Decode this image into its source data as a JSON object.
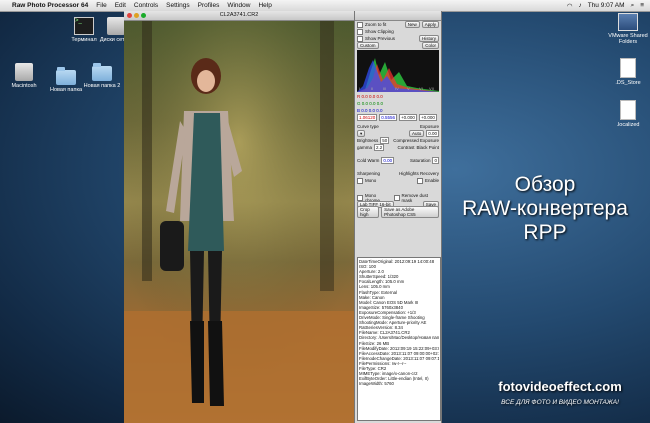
{
  "menubar": {
    "app_name": "Raw Photo Processor 64",
    "items": [
      "File",
      "Edit",
      "Controls",
      "Settings",
      "Profiles",
      "Window",
      "Help"
    ],
    "clock": "Thu 9:07 AM"
  },
  "desktop_icons": [
    {
      "label": "Терминал",
      "kind": "terminal"
    },
    {
      "label": "Диски сети 2",
      "kind": "drive"
    },
    {
      "label": "Macintosh",
      "kind": "drive"
    },
    {
      "label": "Новая папка",
      "kind": "folder"
    },
    {
      "label": "Новая папка 2",
      "kind": "folder"
    },
    {
      "label": "VMware Shared Folders",
      "kind": "apps"
    },
    {
      "label": ".DS_Store",
      "kind": "doc"
    },
    {
      "label": ".localized",
      "kind": "doc"
    }
  ],
  "photo_window": {
    "title": "CL2A3741.CR2"
  },
  "panel": {
    "zoom_to_fit": "Zoom to fit",
    "show_clipping": "Show Clipping",
    "show_previous": "Show Previous",
    "btn_apply": "Apply",
    "btn_new": "New",
    "btn_history": "History",
    "custom": "Custom",
    "color": "Color",
    "hist_labels": [
      "I",
      "II",
      "III",
      "IV",
      "V",
      "VI",
      "VII"
    ],
    "rgb_r": "R 0.0 0.0 0.0",
    "rgb_g": "G 0.0 0.0 0.0",
    "rgb_b": "B 0.0 0.0 0.0",
    "v1": "1.06120",
    "v2": "0.5556",
    "v3": "+0.000",
    "v4": "+0.000",
    "curve_type": "Curve type",
    "exposure": "Exposure",
    "brightness": "Brightness",
    "brightness_val": "50",
    "gamma": "gamma",
    "gamma_val": "2.2",
    "compressed": "Compressed Exposure",
    "contrast": "Contrast",
    "black_point": "Black Point",
    "cold_warm": "Cold Warm",
    "cold_val": "0.00",
    "saturation": "Saturation",
    "sat_val": "0",
    "sharpening": "Sharpening",
    "highlight": "Highlights Recovery",
    "auto": "Auto",
    "mono": "Mono",
    "enable": "Enable",
    "mono_chrome": "Mono chrome",
    "remove_dust": "Remove dust mask",
    "lab_tiff": "Lab TIFF 16-bit",
    "save": "Save",
    "crop": "Crop high",
    "save_as": "Save as Adobe Photoshop CS5"
  },
  "metadata": [
    "DateTimeOriginal: 2012:09:19 14:00:48",
    "ISO: 100",
    "Aperture: 2.0",
    "ShutterSpeed: 1/320",
    "FocalLength: 105.0 mm",
    "Lens: 105.0 mm",
    "FlashType: External",
    "Make: Canon",
    "Model: Canon EOS 5D Mark III",
    "ImageSize: 5760x3840",
    "ExposureCompensation: +1/3",
    "DriveMode: Single-frame Shooting",
    "ShootingMode: Aperture-priority AE",
    "RatSeriesVersion: 8.34",
    "FileName: CL2A3741.CR2",
    "Directory: /Users/Mac/Desktop/Новая папка 2",
    "FileSize: 26 MB",
    "FileModifyDate: 2012:09:19 15:22:09+03:00",
    "FileAccessDate: 2013:11:07 09:00:00+02:00",
    "FileInodeChangeDate: 2013:11:07 09:07:12+02:00",
    "FilePermissions: rw-r--r--",
    "FileType: CR2",
    "MIMEType: image/x-canon-cr2",
    "ExifByteOrder: Little-endian (Intel, II)",
    "ImageWidth: 5760"
  ],
  "overlay": {
    "line1": "Обзор",
    "line2": "RAW-конвертера",
    "line3": "RPP"
  },
  "watermark": {
    "site": "fotovideoeffect.com",
    "tagline": "ВСЕ ДЛЯ ФОТО И ВИДЕО МОНТАЖА!"
  }
}
